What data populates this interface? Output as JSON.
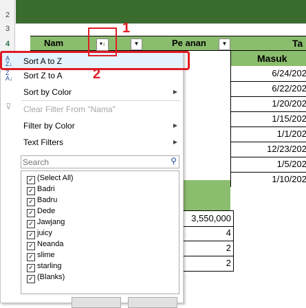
{
  "sheet": {
    "row_numbers": [
      "2",
      "3",
      "4"
    ],
    "headers": {
      "nama_partial": "Nam",
      "pembelian_partial": "Pe    anan",
      "masuk": "Masuk",
      "tanggal_partial": "Ta"
    },
    "dates": [
      "6/24/202",
      "6/22/202",
      "1/20/202",
      "1/15/202",
      "1/1/202",
      "12/23/202",
      "1/5/202",
      "1/10/202"
    ],
    "numbers": [
      "3,550,000",
      "4",
      "2",
      "2"
    ]
  },
  "menu": {
    "sort_az": "Sort A to Z",
    "sort_za": "Sort Z to A",
    "sort_color": "Sort by Color",
    "clear_filter": "Clear Filter From \"Nama\"",
    "filter_color": "Filter by Color",
    "text_filters": "Text Filters",
    "search_placeholder": "Search",
    "items": [
      "(Select All)",
      "Badri",
      "Badru",
      "Dede",
      "Jawjang",
      "juicy",
      "Neanda",
      "slime",
      "starling",
      "(Blanks)"
    ]
  },
  "annotations": {
    "step1": "1",
    "step2": "2"
  },
  "colors": {
    "header_green": "#8bbd6e",
    "dark_green": "#3a6b2f",
    "annotation_red": "#e01b24",
    "menu_highlight": "#e5f3ff"
  }
}
